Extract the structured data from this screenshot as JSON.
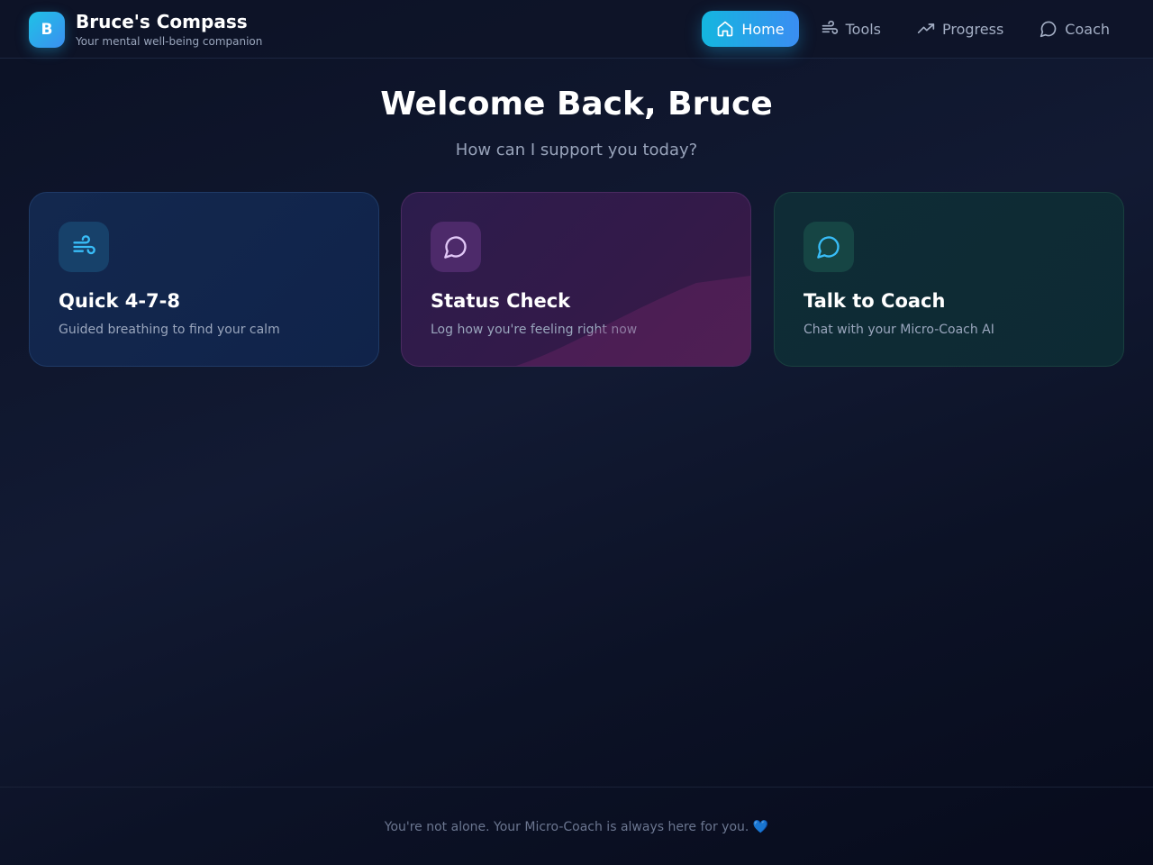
{
  "brand": {
    "logo_letter": "B",
    "title": "Bruce's Compass",
    "subtitle": "Your mental well-being companion"
  },
  "nav": {
    "items": [
      {
        "label": "Home",
        "icon": "home-icon",
        "active": true
      },
      {
        "label": "Tools",
        "icon": "wind-icon",
        "active": false
      },
      {
        "label": "Progress",
        "icon": "trending-up-icon",
        "active": false
      },
      {
        "label": "Coach",
        "icon": "chat-bubble-icon",
        "active": false
      }
    ]
  },
  "hero": {
    "title": "Welcome Back, Bruce",
    "subtitle": "How can I support you today?"
  },
  "cards": [
    {
      "title": "Quick 4-7-8",
      "description": "Guided breathing to find your calm",
      "icon": "wind-icon",
      "accent": "#38bdf8"
    },
    {
      "title": "Status Check",
      "description": "Log how you're feeling right now",
      "icon": "chat-bubble-icon",
      "accent": "#d6b4f5"
    },
    {
      "title": "Talk to Coach",
      "description": "Chat with your Micro-Coach AI",
      "icon": "chat-bubble-icon",
      "accent": "#38bdf8"
    }
  ],
  "footer": {
    "text": "You're not alone. Your Micro-Coach is always here for you.",
    "heart": "💙"
  },
  "colors": {
    "accent_gradient_start": "#14b6df",
    "accent_gradient_end": "#3a8df2",
    "background": "#0b1124"
  }
}
